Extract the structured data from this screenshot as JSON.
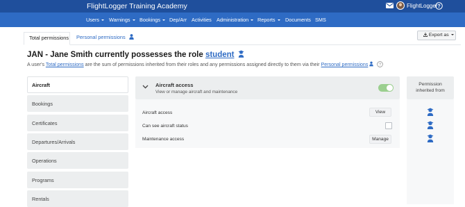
{
  "app": {
    "title": "FlightLogger Training Academy",
    "user_name": "FlightLogger"
  },
  "nav": [
    {
      "label": "Users",
      "dropdown": true
    },
    {
      "label": "Warnings",
      "dropdown": true
    },
    {
      "label": "Bookings",
      "dropdown": true
    },
    {
      "label": "Dep/Arr",
      "dropdown": false
    },
    {
      "label": "Activities",
      "dropdown": false
    },
    {
      "label": "Administration",
      "dropdown": true
    },
    {
      "label": "Reports",
      "dropdown": true
    },
    {
      "label": "Documents",
      "dropdown": false
    },
    {
      "label": "SMS",
      "dropdown": false
    }
  ],
  "tabs": {
    "total": "Total permissions",
    "personal": "Personal permissions"
  },
  "export_label": "Export as",
  "heading": {
    "prefix": "JAN - Jane Smith currently possesses the role",
    "role": "student"
  },
  "subtext": {
    "part1": "A user's",
    "link1": "Total permissions",
    "part2": "are the sum of permissions inherited from their roles and any permissions assigned directly to them via their",
    "link2": "Personal permissions"
  },
  "categories": [
    "Aircraft",
    "Bookings",
    "Certificates",
    "Departures/Arrivals",
    "Operations",
    "Programs",
    "Rentals"
  ],
  "panel": {
    "title": "Aircraft access",
    "description": "View or manage aircraft and maintenance",
    "enabled": true,
    "permissions": [
      {
        "label": "Aircraft access",
        "control": "button",
        "value": "View"
      },
      {
        "label": "Can see aircraft status",
        "control": "checkbox",
        "checked": false
      },
      {
        "label": "Maintenance access",
        "control": "button",
        "value": "Manage"
      }
    ]
  },
  "inherited": {
    "header_line1": "Permission",
    "header_line2": "inherited from",
    "icon": "student-graduate-icon"
  },
  "colors": {
    "header": "#1f4f9c",
    "nav": "#2e6bc4",
    "link": "#2e6bc4",
    "toggle_on": "#9bcf8f"
  }
}
